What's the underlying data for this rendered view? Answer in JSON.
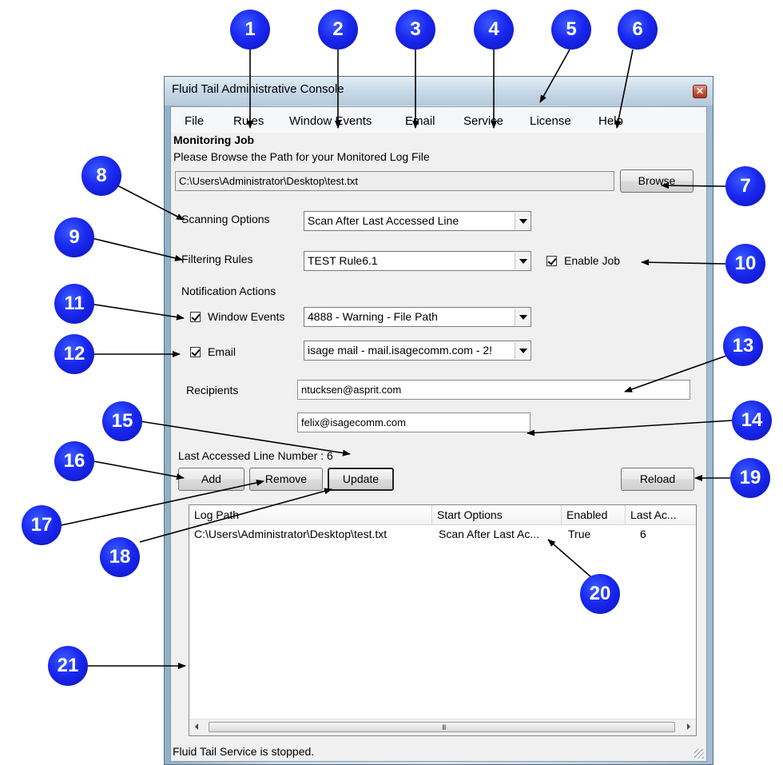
{
  "window": {
    "title": "Fluid Tail Administrative Console",
    "close_glyph": "✕"
  },
  "menu": [
    "File",
    "Rules",
    "Window Events",
    "Email",
    "Service",
    "License",
    "Help"
  ],
  "section": {
    "title": "Monitoring Job",
    "instruction": "Please Browse the Path for your Monitored Log File"
  },
  "log_path": {
    "value": "C:\\Users\\Administrator\\Desktop\\test.txt",
    "browse_label": "Browse"
  },
  "scanning": {
    "label": "Scanning Options",
    "selected": "Scan After Last Accessed Line"
  },
  "filtering": {
    "label": "Filtering Rules",
    "selected": "TEST Rule6.1"
  },
  "enable_job": {
    "label": "Enable Job",
    "checked": true
  },
  "notification": {
    "label": "Notification Actions",
    "window_events_label": "Window Events",
    "window_events_checked": true,
    "window_events_selected": "4888 - Warning - File Path",
    "email_label": "Email",
    "email_checked": true,
    "email_selected": "isage mail - mail.isagecomm.com - 2!"
  },
  "recipients": {
    "label": "Recipients",
    "recipient_1": "ntucksen@asprit.com",
    "recipient_2": "felix@isagecomm.com"
  },
  "last_accessed": "Last Accessed Line Number : 6",
  "buttons": {
    "add": "Add",
    "remove": "Remove",
    "update": "Update",
    "reload": "Reload"
  },
  "table": {
    "columns": [
      "Log Path",
      "Start Options",
      "Enabled",
      "Last Ac..."
    ],
    "rows": [
      [
        "C:\\Users\\Administrator\\Desktop\\test.txt",
        "Scan After Last Ac...",
        "True",
        "6"
      ]
    ],
    "scroll_grip": "III"
  },
  "status": "Fluid Tail Service is stopped.",
  "callouts": [
    "1",
    "2",
    "3",
    "4",
    "5",
    "6",
    "7",
    "8",
    "9",
    "10",
    "11",
    "12",
    "13",
    "14",
    "15",
    "16",
    "17",
    "18",
    "19",
    "20",
    "21"
  ],
  "colors": {
    "callout_blue": "#1a28f0",
    "window_client": "#f0f0f0",
    "close_button": "#c65437"
  }
}
